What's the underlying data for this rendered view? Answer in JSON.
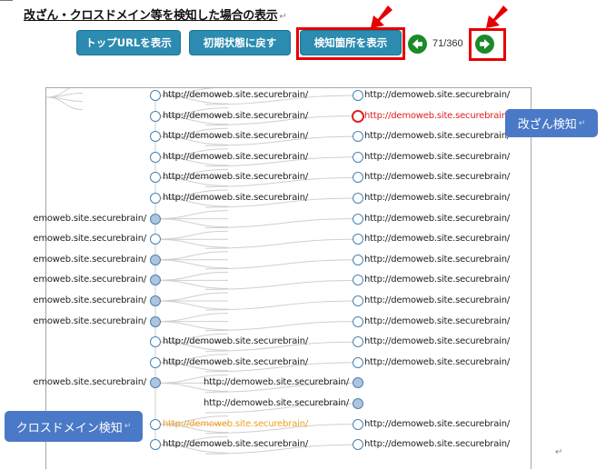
{
  "title": "改ざん・クロスドメイン等を検知した場合の表示",
  "para_mark": "↵",
  "toolbar": {
    "top_url_label": "トップURLを表示",
    "reset_label": "初期状態に戻す",
    "show_detect_label": "検知箇所を表示",
    "counter": "71/360"
  },
  "graph": {
    "right_nodes": [
      {
        "label": "http://demoweb.site.securebrain/",
        "status": "normal"
      },
      {
        "label": "http://demoweb.site.securebrain/",
        "status": "alert"
      },
      {
        "label": "http://demoweb.site.securebrain/",
        "status": "normal"
      },
      {
        "label": "http://demoweb.site.securebrain/",
        "status": "normal"
      },
      {
        "label": "http://demoweb.site.securebrain/",
        "status": "normal"
      },
      {
        "label": "http://demoweb.site.securebrain/",
        "status": "normal"
      },
      {
        "label": "http://demoweb.site.securebrain/",
        "status": "normal"
      },
      {
        "label": "http://demoweb.site.securebrain/",
        "status": "normal"
      },
      {
        "label": "http://demoweb.site.securebrain/",
        "status": "normal"
      },
      {
        "label": "http://demoweb.site.securebrain/",
        "status": "normal"
      },
      {
        "label": "http://demoweb.site.securebrain/",
        "status": "normal"
      },
      {
        "label": "http://demoweb.site.securebrain/",
        "status": "normal"
      },
      {
        "label": "http://demoweb.site.securebrain/",
        "status": "normal"
      },
      {
        "label": "http://demoweb.site.securebrain/",
        "status": "normal"
      },
      {
        "label": "http://demoweb.site.securebrain/",
        "status": "normal"
      },
      {
        "label": "http://demoweb.site.securebrain/",
        "status": "normal"
      },
      {
        "label": "http://demoweb.site.securebrain/",
        "status": "normal"
      },
      {
        "label": "http://demoweb.site.securebrain/",
        "status": "normal"
      }
    ],
    "left_nodes": [
      {
        "label": "http://demoweb.site.securebrain/",
        "side": "right",
        "status": "normal"
      },
      {
        "label": "http://demoweb.site.securebrain/",
        "side": "right",
        "status": "normal"
      },
      {
        "label": "http://demoweb.site.securebrain/",
        "side": "right",
        "status": "normal"
      },
      {
        "label": "http://demoweb.site.securebrain/",
        "side": "right",
        "status": "normal"
      },
      {
        "label": "http://demoweb.site.securebrain/",
        "side": "right",
        "status": "normal"
      },
      {
        "label": "http://demoweb.site.securebrain/",
        "side": "right",
        "status": "normal"
      },
      {
        "label": "emoweb.site.securebrain/",
        "side": "left",
        "status": "filled"
      },
      {
        "label": "emoweb.site.securebrain/",
        "side": "left",
        "status": "hub"
      },
      {
        "label": "emoweb.site.securebrain/",
        "side": "left",
        "status": "filled"
      },
      {
        "label": "emoweb.site.securebrain/",
        "side": "left",
        "status": "filled"
      },
      {
        "label": "emoweb.site.securebrain/",
        "side": "left",
        "status": "filled"
      },
      {
        "label": "emoweb.site.securebrain/",
        "side": "left",
        "status": "filled"
      },
      {
        "label": "http://demoweb.site.securebrain/",
        "side": "right",
        "status": "normal"
      },
      {
        "label": "http://demoweb.site.securebrain/",
        "side": "right",
        "status": "normal"
      },
      {
        "label": "emoweb.site.securebrain/",
        "side": "left",
        "status": "filled"
      },
      {
        "label": "",
        "side": "none",
        "status": "hidden"
      },
      {
        "label": "http://demoweb.site.securebrain/",
        "side": "right",
        "status": "crossdomain"
      },
      {
        "label": "http://demoweb.site.securebrain/",
        "side": "right",
        "status": "normal"
      }
    ],
    "mid_nodes": [
      {
        "label": "http://demoweb.site.securebrain/",
        "status": "filled"
      },
      {
        "label": "http://demoweb.site.securebrain/",
        "status": "filled"
      }
    ]
  },
  "callouts": {
    "tamper": "改ざん検知",
    "crossdomain": "クロスドメイン検知"
  },
  "colors": {
    "button": "#2b8bb0",
    "highlight": "#e60000",
    "nav": "#1a8a2a",
    "node_border": "#4682b4",
    "node_fill": "#b0c4de",
    "alert": "#e02020",
    "crossdomain": "#f0a020",
    "callout": "#4a79c7"
  },
  "icons": {
    "prev": "arrow-left-icon",
    "next": "arrow-right-icon",
    "pointer": "red-arrow-icon"
  }
}
